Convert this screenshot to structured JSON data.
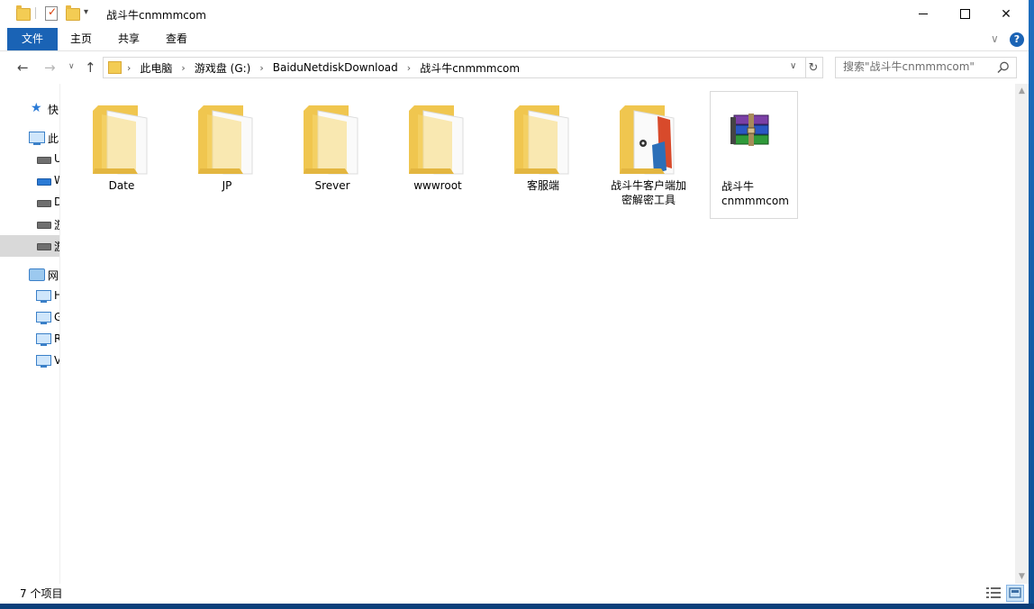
{
  "window": {
    "title": "战斗牛cnmmmcom",
    "controls": {
      "minimize": "—",
      "maximize": "□",
      "close": "✕"
    }
  },
  "ribbon": {
    "tabs": [
      {
        "label": "文件",
        "active": true
      },
      {
        "label": "主页"
      },
      {
        "label": "共享"
      },
      {
        "label": "查看"
      }
    ],
    "help": "?",
    "expand_chevron": "∨"
  },
  "address": {
    "crumbs": [
      "此电脑",
      "游戏盘 (G:)",
      "BaiduNetdiskDownload",
      "战斗牛cnmmmcom"
    ],
    "search_placeholder": "搜索\"战斗牛cnmmmcom\""
  },
  "navpane": {
    "items": [
      {
        "label": "快",
        "icon": "star-icon"
      },
      {
        "label": "此",
        "icon": "this-pc-icon"
      },
      {
        "label": "U",
        "icon": "drive-icon"
      },
      {
        "label": "W",
        "icon": "network-drive-icon"
      },
      {
        "label": "D",
        "icon": "drive-icon"
      },
      {
        "label": "游",
        "icon": "drive-icon"
      },
      {
        "label": "游",
        "icon": "drive-icon",
        "selected": true
      },
      {
        "label": "网",
        "icon": "network-icon"
      },
      {
        "label": "H",
        "icon": "network-pc-icon"
      },
      {
        "label": "G",
        "icon": "network-pc-icon"
      },
      {
        "label": "R",
        "icon": "network-pc-icon"
      },
      {
        "label": "V",
        "icon": "network-pc-icon"
      }
    ]
  },
  "files": [
    {
      "name": "Date",
      "type": "folder"
    },
    {
      "name": "JP",
      "type": "folder"
    },
    {
      "name": "Srever",
      "type": "folder"
    },
    {
      "name": "wwwroot",
      "type": "folder"
    },
    {
      "name": "客服端",
      "type": "folder"
    },
    {
      "name": "战斗牛客户端加密解密工具",
      "name_line1": "战斗牛客户端加",
      "name_line2": "密解密工具",
      "type": "folder-app"
    },
    {
      "name": "战斗牛cnmmmcom",
      "name_line1": "战斗牛",
      "name_line2": "cnmmmcom",
      "type": "rar-archive",
      "selected": true
    }
  ],
  "status": {
    "item_count": "7 个项目"
  },
  "colors": {
    "accent": "#1a63b5",
    "folder": "#f3cc54",
    "selection": "#d9d9d9"
  }
}
